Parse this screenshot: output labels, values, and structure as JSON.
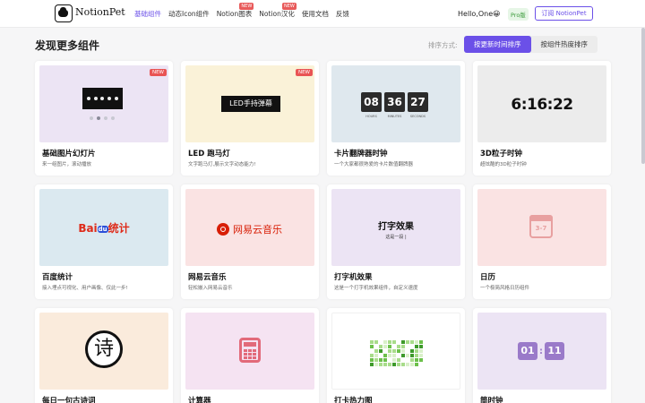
{
  "header": {
    "brand": "NotionPet",
    "nav": [
      {
        "label": "基础组件",
        "active": true,
        "badge": ""
      },
      {
        "label": "动态Icon组件",
        "active": false,
        "badge": ""
      },
      {
        "label": "Notion图表",
        "active": false,
        "badge": "NEW"
      },
      {
        "label": "Notion汉化",
        "active": false,
        "badge": "NEW"
      },
      {
        "label": "使用文档",
        "active": false,
        "badge": ""
      },
      {
        "label": "反馈",
        "active": false,
        "badge": ""
      }
    ],
    "greeting": "Hello,One😀",
    "pro_badge": "Pro版",
    "subscribe_label": "订阅 NotionPet"
  },
  "section": {
    "title": "发现更多组件",
    "sort_label": "排序方式:",
    "sort_options": [
      "按更新时间排序",
      "按组件热度排序"
    ],
    "sort_active": 0
  },
  "cards": [
    {
      "title": "基础图片幻灯片",
      "desc": "来一组图片，滚动播放",
      "bg": "#ece4f4",
      "badge": "NEW"
    },
    {
      "title": "LED 跑马灯",
      "desc": "文字跑马灯,展示文字动态能力!",
      "bg": "#faf2d8",
      "badge": "NEW",
      "led_text": "LED手持弹幕"
    },
    {
      "title": "卡片翻牌器时钟",
      "desc": "一个大家都很熟爱的卡片数值翻牌器",
      "bg": "#dfe8ee",
      "badge": "",
      "flip": [
        "08",
        "36",
        "27"
      ],
      "flip_labels": [
        "HOURS",
        "MINUTES",
        "SECONDS"
      ]
    },
    {
      "title": "3D粒子时钟",
      "desc": "超炫酷的3D粒子时钟",
      "bg": "#ececec",
      "badge": "",
      "time": "6:16:22"
    },
    {
      "title": "百度统计",
      "desc": "接入埋点可视化、用户画像、仅此一步!",
      "bg": "#dbe9f0",
      "badge": "",
      "logo_a": "Bai",
      "logo_b": "du",
      "logo_c": "统计"
    },
    {
      "title": "网易云音乐",
      "desc": "轻松嵌入网易云音乐",
      "bg": "#fae3e3",
      "badge": "",
      "logo_text": "网易云音乐"
    },
    {
      "title": "打字机效果",
      "desc": "这是一个打字机效果组件，自定义速度",
      "bg": "#ece4f4",
      "badge": "",
      "headline": "打字效果",
      "sub": "这是一段 |"
    },
    {
      "title": "日历",
      "desc": "一个极简风格日历组件",
      "bg": "#fae3e3",
      "badge": "",
      "day": "3-7"
    },
    {
      "title": "每日一句古诗词",
      "desc": "",
      "bg": "#faebdc",
      "badge": "",
      "glyph": "诗"
    },
    {
      "title": "计算器",
      "desc": "",
      "bg": "#f5e3f2",
      "badge": ""
    },
    {
      "title": "打卡热力图",
      "desc": "",
      "bg": "#ffffff",
      "badge": ""
    },
    {
      "title": "简时钟",
      "desc": "",
      "bg": "#ece4f4",
      "badge": "",
      "clock": [
        "01",
        "11"
      ]
    }
  ]
}
